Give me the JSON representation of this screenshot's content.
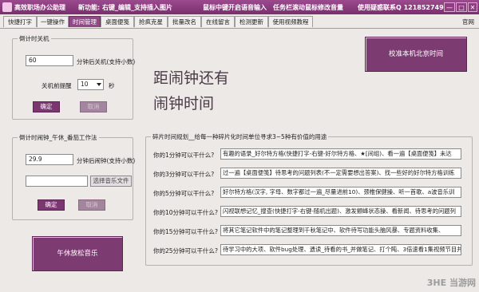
{
  "titlebar": {
    "app_title": "高效职场办公助理",
    "new_feature_label": "新功能:",
    "new_feature_text": "右键_编辑_支持插入图片",
    "hint_middle_click": "鼠标中键开启语音输入",
    "hint_taskbar_scroll": "任务栏滚动鼠标修改音量",
    "hint_contact": "使用疑惑联系Q 121852749",
    "btn_minimize": "—",
    "btn_maximize": "□",
    "btn_close": "✕"
  },
  "tabs": [
    {
      "label": "快捷打字"
    },
    {
      "label": "一键操作"
    },
    {
      "label": "时间管理"
    },
    {
      "label": "桌面便笺"
    },
    {
      "label": "抢疯克星"
    },
    {
      "label": "批量改名"
    },
    {
      "label": "在线留言"
    },
    {
      "label": "检测更新"
    },
    {
      "label": "使用视频教程"
    }
  ],
  "active_tab": "时间管理",
  "official_site": "官网",
  "shutdown": {
    "group_title": "倒计时关机",
    "minutes_value": "60",
    "minutes_suffix": "分钟后关机(支持小数)",
    "remind_label": "关机前提醒",
    "remind_value": "10",
    "remind_unit": "秒",
    "confirm": "确定",
    "cancel": "取消"
  },
  "sync_time_button": "校准本机北京时间",
  "countdown_text_line1": "距闹钟还有",
  "countdown_text_line2": "闹钟时间",
  "alarm": {
    "group_title": "倒计时闹钟_午休_番茄工作法",
    "minutes_value": "29.9",
    "minutes_suffix": "分钟后闹钟(支持小数)",
    "music_path": "",
    "choose_music": "选择音乐文件",
    "confirm": "确定",
    "cancel": "取消",
    "nap_music": "午休放松音乐"
  },
  "fragments": {
    "group_title": "碎片时间规划__给每一种碎片化时间单位寻求3~5种有价值的用途",
    "rows": [
      {
        "q": "你的1分钟可以干什么?",
        "a": "有趣的语录_好尔特方格(快捷打字-右键-好尔特方格、★[间组)、看一遍【桌面便笺】未达"
      },
      {
        "q": "你的3分钟可以干什么?",
        "a": "过一遍【桌面便笺】待思考的问题列表(不一定需要想出答案)、找一些好的好尔特方格训练"
      },
      {
        "q": "你的5分钟可以干什么?",
        "a": "好尔特方格(汉字, 字母、数字都过一遍_尽量进前10)、颈椎保健操、听一首歌、a波音乐训"
      },
      {
        "q": "你的10分钟可以干什么?",
        "a": "闪视联想记忆_搜查(快捷打字-右键-随机出题)、激发颤峰状态操、看新闻、待思考的问题列"
      },
      {
        "q": "你的15分钟可以干什么?",
        "a": "将其它笔记软件中的笔记整理到千秋笔记中、软件待写功能头脑风暴、专题资料收集、"
      },
      {
        "q": "你的25分钟可以干什么?",
        "a": "待学习中的大项、软件bug处理、遗读_待看的书_并做笔记、打个盹、3倍速看1集视频节目并"
      }
    ]
  },
  "watermark": "3HE 当游网"
}
